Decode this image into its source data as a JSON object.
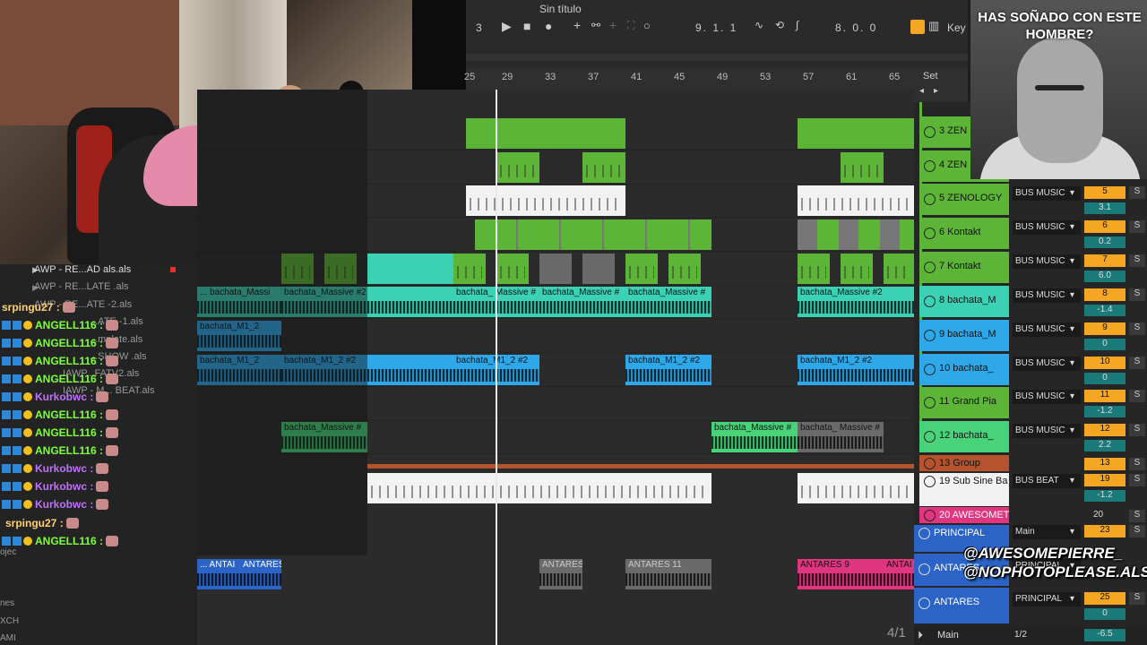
{
  "daw": {
    "title": "Sin título",
    "tempo_marker": "3",
    "position": "9. 1. 1",
    "loop_length": "8. 0. 0",
    "key_label": "Key",
    "set_label": "Set",
    "ruler": [
      "25",
      "29",
      "33",
      "37",
      "41",
      "45",
      "49",
      "53",
      "57",
      "61",
      "65"
    ],
    "bottom_position": "4/1",
    "main_label": "Main",
    "main_vol": "-6.5",
    "main_ratio": "1/2"
  },
  "files": [
    {
      "name": "AWP - RE...AD als.als"
    },
    {
      "name": "AWP - RE...LATE .als"
    },
    {
      "name": "AWP - RE...ATE -2.als"
    },
    {
      "name": "...ATE -1.als"
    },
    {
      "name": "...mplate.als"
    },
    {
      "name": "...SHOW .als"
    },
    {
      "name": "IAWP...FATV2.als"
    },
    {
      "name": "IAWP - M... BEAT.als"
    }
  ],
  "chat": [
    {
      "user": "srpingu27"
    },
    {
      "user": "ANGELL116"
    },
    {
      "user": "ANGELL116"
    },
    {
      "user": "ANGELL116"
    },
    {
      "user": "ANGELL116"
    },
    {
      "user": "Kurkobwc"
    },
    {
      "user": "ANGELL116"
    },
    {
      "user": "ANGELL116"
    },
    {
      "user": "ANGELL116"
    },
    {
      "user": "Kurkobwc"
    },
    {
      "user": "Kurkobwc"
    },
    {
      "user": "Kurkobwc"
    },
    {
      "user": "srpingu27"
    },
    {
      "user": "ANGELL116"
    }
  ],
  "left_misc": [
    "ojec",
    "nes",
    "XCH",
    "AMI"
  ],
  "clips": {
    "massive_a": "... bachata_Massi",
    "massive_b": "bachata_Massive #2",
    "massive_c": "bachata_ Massive #",
    "massive_d": "bachata_Massive #",
    "massive_e": "bachata_Massive #",
    "massive_f": "bachata_Massive #2",
    "m1_a": "bachata_M1_2",
    "m1_b": "bachata_M1_2",
    "m1_c": "bachata_M1_2 #2",
    "m1_d": "bachata_M1_2 #2",
    "m1_e": "bachata_M1_2 #2",
    "m1_f": "bachata_M1_2 #2",
    "mas3_a": "bachata_Massive #",
    "mas3_b": "bachata_Massive #",
    "mas3_c": "bachata_ Massive #",
    "ant_a": "... ANTAI",
    "ant_b": "ANTARES",
    "ant_c": "ANTARES",
    "ant_d": "ANTARES 11",
    "ant_e": "ANTARES 9",
    "ant_f": "ANTAI"
  },
  "tracks": [
    {
      "name": "3 ZEN",
      "bus": "",
      "num": "",
      "vol": ""
    },
    {
      "name": "4 ZEN",
      "bus": "",
      "num": "",
      "vol": ""
    },
    {
      "name": "5 ZENOLOGY",
      "bus": "BUS MUSIC",
      "num": "5",
      "vol": "3.1"
    },
    {
      "name": "6 Kontakt",
      "bus": "BUS MUSIC",
      "num": "6",
      "vol": "0.2"
    },
    {
      "name": "7 Kontakt",
      "bus": "BUS MUSIC",
      "num": "7",
      "vol": "6.0"
    },
    {
      "name": "8 bachata_M",
      "bus": "BUS MUSIC",
      "num": "8",
      "vol": "-1.4"
    },
    {
      "name": "9 bachata_M",
      "bus": "BUS MUSIC",
      "num": "9",
      "vol": "0"
    },
    {
      "name": "10 bachata_",
      "bus": "BUS MUSIC",
      "num": "10",
      "vol": "0"
    },
    {
      "name": "11 Grand Pia",
      "bus": "BUS MUSIC",
      "num": "11",
      "vol": "-1.2"
    },
    {
      "name": "12 bachata_",
      "bus": "BUS MUSIC",
      "num": "12",
      "vol": "2.2"
    },
    {
      "name": "13 Group",
      "bus": "",
      "num": "13",
      "vol": ""
    },
    {
      "name": "19 Sub Sine Ba",
      "bus": "BUS BEAT",
      "num": "19",
      "vol": "-1.2"
    },
    {
      "name": "20 AWESOMET",
      "bus": "",
      "num": "20",
      "vol": ""
    },
    {
      "name": "PRINCIPAL",
      "bus": "Main",
      "num": "23",
      "vol": ""
    },
    {
      "name": "ANTARES",
      "bus": "PRINCIPAL",
      "num": "",
      "vol": ""
    },
    {
      "name": "ANTARES",
      "bus": "PRINCIPAL",
      "num": "25",
      "vol": "0"
    }
  ],
  "overlay": {
    "question": "HAS SOÑADO CON ESTE HOMBRE?",
    "handle1": "@AWESOMEPIERRE_",
    "handle2": "@NOPHOTOPLEASE.ALS"
  },
  "colors": {
    "accent": "#f5a623",
    "green_clip": "#5cb536",
    "teal_clip": "#3bd1b5",
    "blue_clip": "#2ea8e8",
    "pink_clip": "#e0357f"
  }
}
